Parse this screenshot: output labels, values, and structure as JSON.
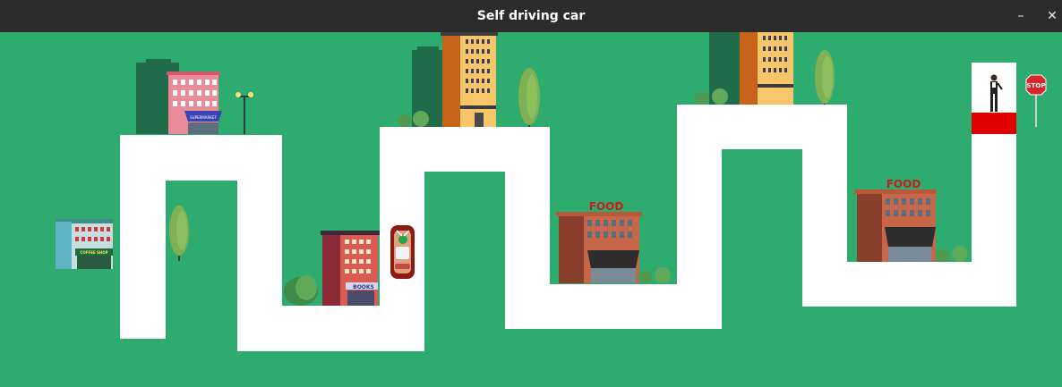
{
  "window": {
    "title": "Self driving car",
    "minimize_glyph": "–",
    "close_glyph": "✕"
  },
  "scene": {
    "background_color": "#2EAB6E",
    "road_color": "#FFFFFF",
    "finish_color": "#E00000"
  },
  "signs": {
    "food_1": "FOOD",
    "food_2": "FOOD",
    "books": "BOOKS",
    "coffee_shop": "COFFEE SHOP",
    "supermarket": "SUPERMARKET",
    "stop": "STOP"
  },
  "icons": [
    "car-icon",
    "stop-sign-icon",
    "person-icon",
    "street-lamp-icon",
    "tree-icon",
    "bush-icon"
  ]
}
